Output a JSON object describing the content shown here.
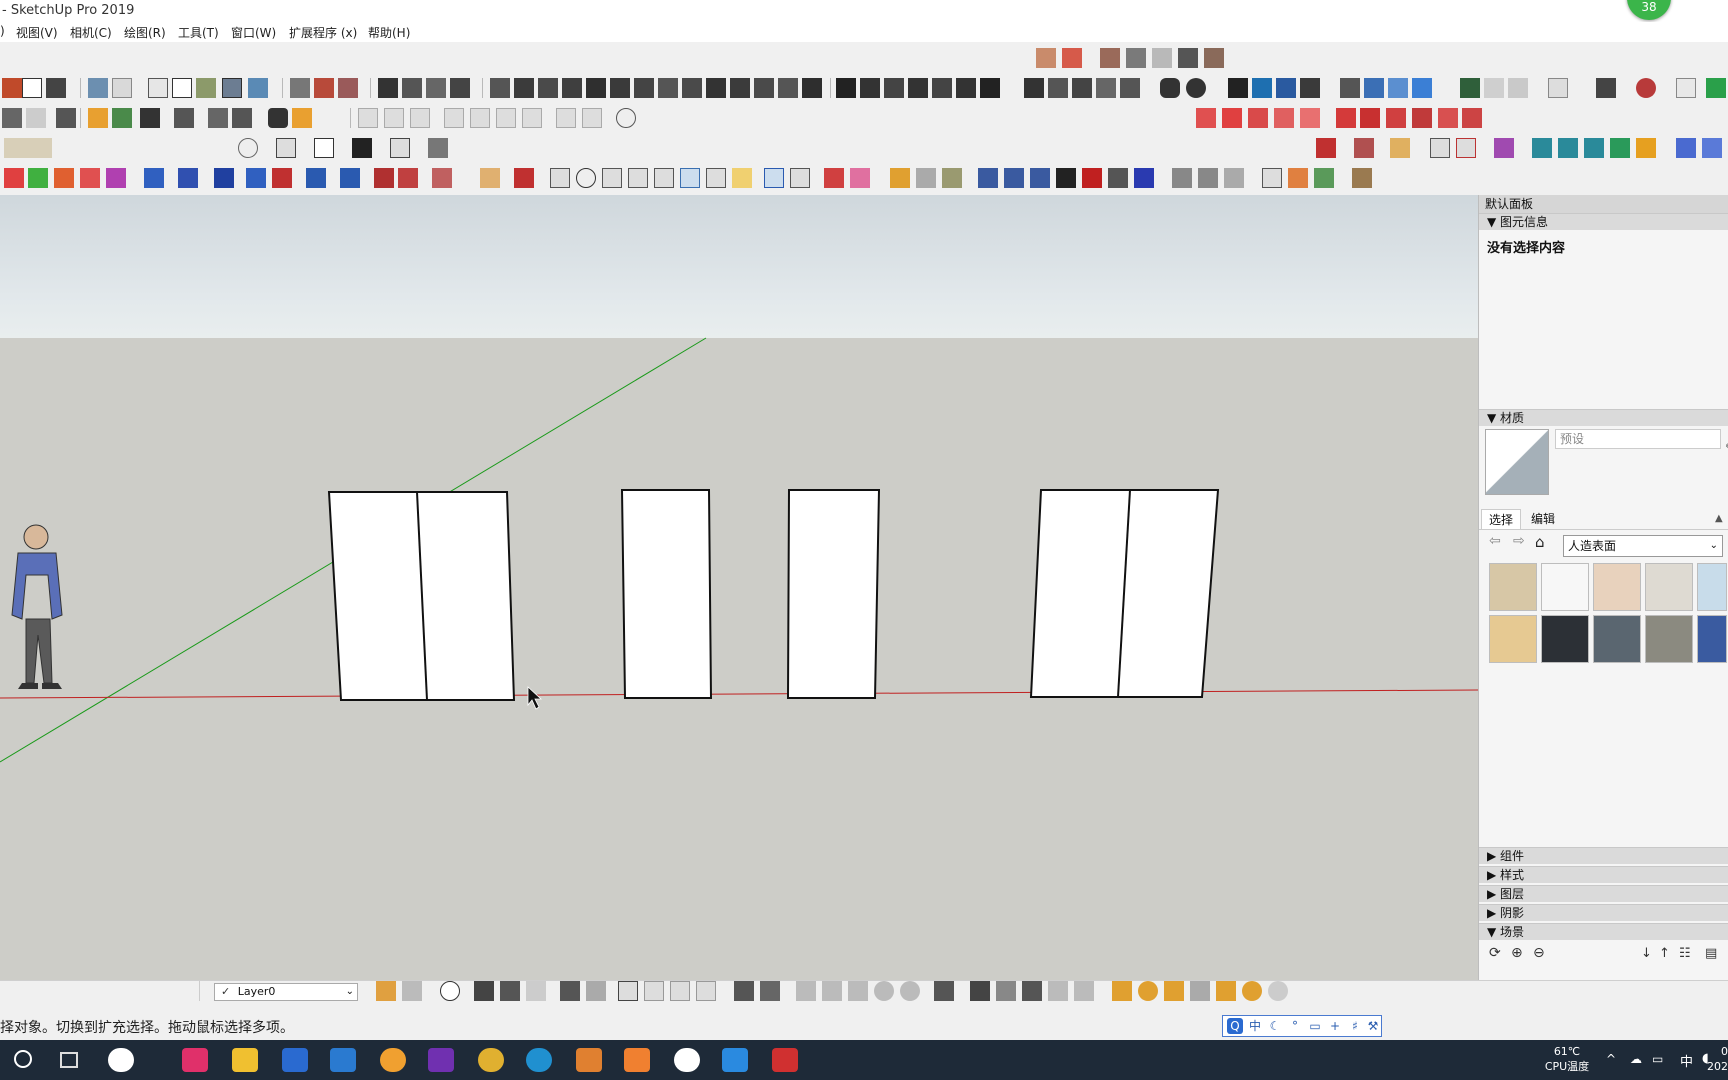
{
  "window": {
    "title": "- SketchUp Pro 2019",
    "badge_count": "38"
  },
  "menu": [
    "视图(V)",
    "相机(C)",
    "绘图(R)",
    "工具(T)",
    "窗口(W)",
    "扩展程序 (x)",
    "帮助(H)"
  ],
  "tray": {
    "title": "默认面板",
    "entity_info": {
      "header": "图元信息",
      "empty_text": "没有选择内容"
    },
    "materials": {
      "header": "材质",
      "name_placeholder": "预设",
      "tabs": [
        "选择",
        "编辑"
      ],
      "library_select": "人造表面",
      "swatch_colors": [
        "#d7c7a6",
        "#f7f7f7",
        "#e8d2bd",
        "#dedad2",
        "#c8dcea",
        "#e6c992",
        "#2c3036",
        "#5a6670",
        "#8b8a80",
        "#3a5ba0"
      ]
    },
    "sections": [
      "组件",
      "样式",
      "图层",
      "阴影",
      "场景"
    ]
  },
  "status": {
    "layer": "Layer0",
    "hint": "择对象。切换到扩充选择。拖动鼠标选择多项。"
  },
  "taskbar": {
    "temp": "61℃",
    "temp_label": "CPU温度",
    "ime_lang": "中",
    "clock_top": "0",
    "clock_bottom": "202"
  },
  "colors": {
    "red_axis": "#c02020",
    "green_axis": "#1a9a1a",
    "tray_bg": "#f5f5f5"
  }
}
